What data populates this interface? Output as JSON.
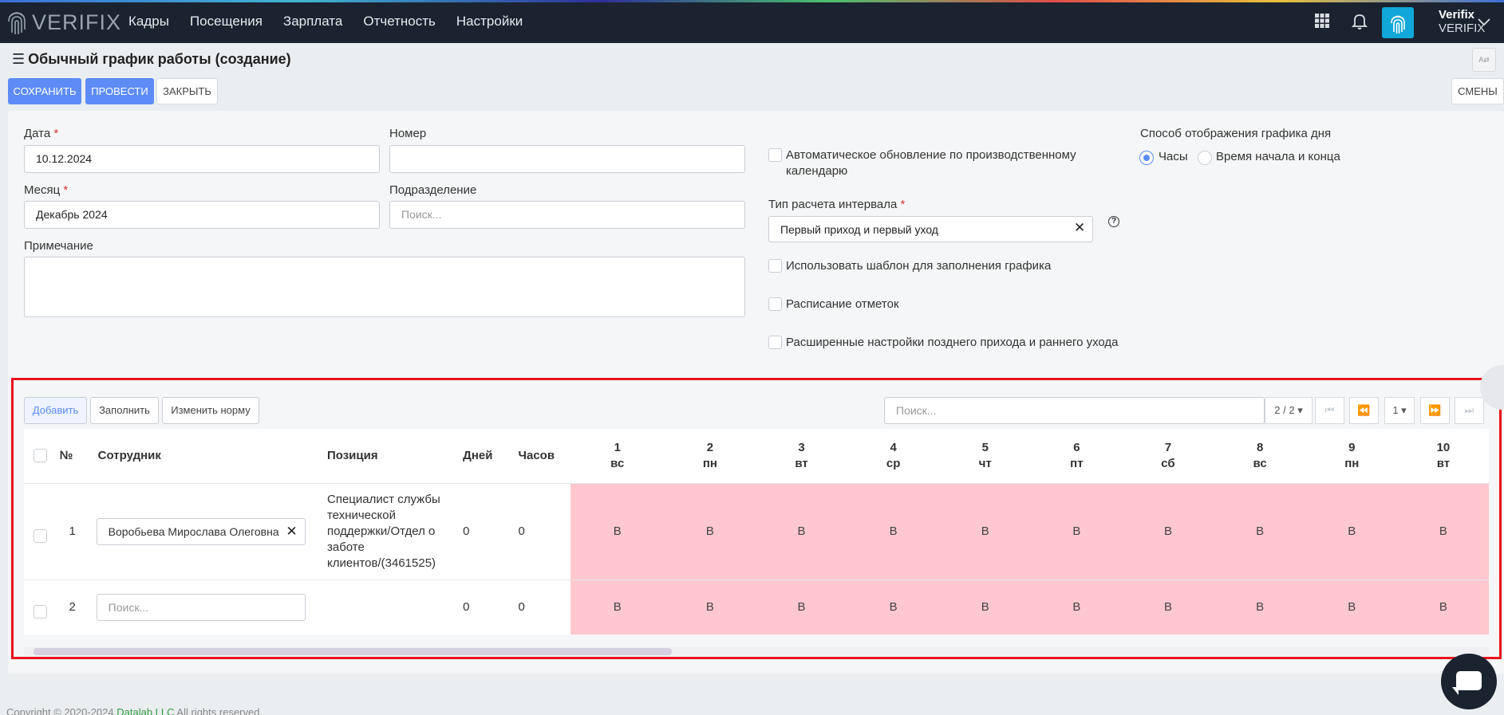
{
  "app": {
    "logo_text": "VERIFIX",
    "menu": [
      "Кадры",
      "Посещения",
      "Зарплата",
      "Отчетность",
      "Настройки"
    ],
    "user_name": "Verifix",
    "user_org": "VERIFIX"
  },
  "page": {
    "title": "Обычный график работы (создание)",
    "buttons": {
      "save": "СОХРАНИТЬ",
      "post": "ПРОВЕСТИ",
      "close": "ЗАКРЫТЬ",
      "shifts": "СМЕНЫ"
    }
  },
  "form": {
    "date_label": "Дата",
    "date_value": "10.12.2024",
    "number_label": "Номер",
    "number_value": "",
    "month_label": "Месяц",
    "month_value": "Декабрь 2024",
    "division_label": "Подразделение",
    "division_placeholder": "Поиск...",
    "note_label": "Примечание",
    "auto_update_label": "Автоматическое обновление по производственному календарю",
    "interval_type_label": "Тип расчета интервала",
    "interval_type_value": "Первый приход и первый уход",
    "use_template_label": "Использовать шаблон для заполнения графика",
    "marks_schedule_label": "Расписание отметок",
    "extended_settings_label": "Расширенные настройки позднего прихода и раннего ухода",
    "display_mode_label": "Способ отображения графика дня",
    "display_mode_options": [
      "Часы",
      "Время начала и конца"
    ],
    "display_mode_selected": "Часы",
    "required_mark": "*"
  },
  "table_toolbar": {
    "add": "Добавить",
    "fill": "Заполнить",
    "change_norm": "Изменить норму",
    "search_placeholder": "Поиск...",
    "count": "2 / 2",
    "page": "1"
  },
  "table": {
    "headers": {
      "num": "№",
      "employee": "Сотрудник",
      "position": "Позиция",
      "days": "Дней",
      "hours": "Часов"
    },
    "day_columns": [
      {
        "day": "1",
        "dow": "вс"
      },
      {
        "day": "2",
        "dow": "пн"
      },
      {
        "day": "3",
        "dow": "вт"
      },
      {
        "day": "4",
        "dow": "ср"
      },
      {
        "day": "5",
        "dow": "чт"
      },
      {
        "day": "6",
        "dow": "пт"
      },
      {
        "day": "7",
        "dow": "сб"
      },
      {
        "day": "8",
        "dow": "вс"
      },
      {
        "day": "9",
        "dow": "пн"
      },
      {
        "day": "10",
        "dow": "вт"
      }
    ],
    "rows": [
      {
        "num": "1",
        "employee": "Воробьева Мирослава Олеговна",
        "position": "Специалист службы технической поддержки/Отдел о заботе клиентов/(3461525)",
        "days": "0",
        "hours": "0",
        "marks": [
          "В",
          "В",
          "В",
          "В",
          "В",
          "В",
          "В",
          "В",
          "В",
          "В"
        ]
      },
      {
        "num": "2",
        "employee_placeholder": "Поиск...",
        "position": "",
        "days": "0",
        "hours": "0",
        "marks": [
          "В",
          "В",
          "В",
          "В",
          "В",
          "В",
          "В",
          "В",
          "В",
          "В"
        ]
      }
    ]
  },
  "footer": {
    "copyright": "Copyright © 2020-2024",
    "company": "Datalab LLC",
    "rights": "All rights reserved."
  },
  "colors": {
    "accent": "#5d8cf6",
    "navbar": "#1b2330",
    "weekend_cell": "#ffc7cf",
    "highlight": "#e8131d"
  }
}
